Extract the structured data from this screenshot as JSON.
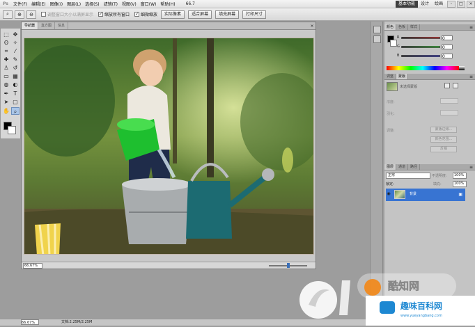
{
  "menubar": {
    "logo": "Ps",
    "items": [
      "文件(F)",
      "编辑(E)",
      "图像(I)",
      "图层(L)",
      "选择(S)",
      "滤镜(T)",
      "视图(V)",
      "窗口(W)",
      "帮助(H)"
    ],
    "zoom_value": "66.7",
    "workspaces": [
      "基本功能",
      "设计",
      "绘画"
    ],
    "active_workspace": "基本功能",
    "window_buttons": [
      "-",
      "□",
      "×"
    ]
  },
  "options_bar": {
    "resize_windows_label": "调整窗口大小以满屏显示",
    "zoom_all_windows_label": "缩放所有窗口",
    "scrubby_zoom_label": "细微缩放",
    "buttons": [
      "实际像素",
      "适合屏幕",
      "填充屏幕",
      "打印尺寸"
    ]
  },
  "document": {
    "tabs": [
      "导航器",
      "直方图",
      "信息"
    ],
    "active_tab": "导航器",
    "zoom_percent": "66.67%",
    "zoom_level": 0.5
  },
  "statusbar": {
    "zoom": "66.67%",
    "doc_info": "文档:2.25M/2.25M"
  },
  "panels": {
    "color": {
      "tabs": [
        "颜色",
        "色板",
        "样式"
      ],
      "channels": [
        "R",
        "G",
        "B"
      ],
      "values": [
        "0",
        "0",
        "0"
      ]
    },
    "adjust": {
      "tabs": [
        "调整",
        "蒙版"
      ],
      "mask_label": "未选择蒙版",
      "density_label": "浓度:",
      "feather_label": "羽化:",
      "refine_label": "调整:",
      "buttons": [
        "蒙版边缘...",
        "颜色范围...",
        "反相"
      ]
    },
    "layers": {
      "tabs": [
        "图层",
        "通道",
        "路径"
      ],
      "blend_mode": "正常",
      "opacity_label": "不透明度:",
      "opacity": "100%",
      "lock_label": "锁定:",
      "fill_label": "填充:",
      "fill": "100%",
      "layer_name": "背景"
    }
  },
  "watermark": {
    "name": "酷知网",
    "sub": "趣味百科网",
    "url": "www.yueyangbang.com"
  },
  "colors": {
    "accent": "#3874d2",
    "active_workspace": "#3f3f3f"
  }
}
